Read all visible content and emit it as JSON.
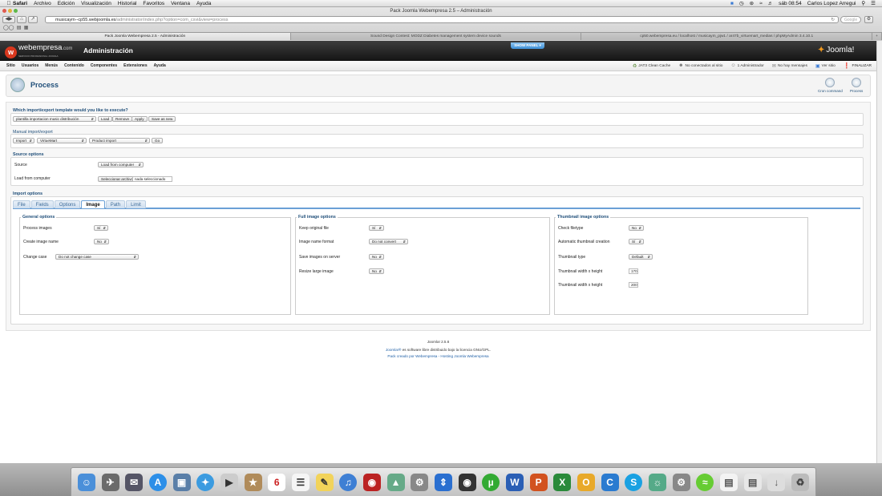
{
  "menubar": {
    "app": "Safari",
    "items": [
      "Archivo",
      "Edición",
      "Visualización",
      "Historial",
      "Favoritos",
      "Ventana",
      "Ayuda"
    ],
    "clock": "sáb 08:54",
    "user": "Carlos Lopez Arregui"
  },
  "browser": {
    "window_title": "Pack Joomla Webempresa 2.5 – Administración",
    "url_host": "musicaym--cp55.webjoomla.es",
    "url_path": "/administrator/index.php?option=com_csvi&view=process",
    "search_placeholder": "Google",
    "tabs": [
      "Pack Joomla Webempresa 2.5 - Administración",
      "Sound Design Contest: MODZ Diabetes management system device sounds",
      "cp50.webempresa.eu / localhost / musicaym_pjw1 / ar47b_virtuemart_medias / phpMyAdmin 3.4.10.1"
    ]
  },
  "header": {
    "brand": "webempresa",
    "brand_suffix": ".com",
    "brand_sub": "SERVICIO PROFESIONAL JOOMLA",
    "title": "Administración",
    "show_panel": "SHOW PANEL ▾",
    "joomla": "Joomla!"
  },
  "jmenu": {
    "items": [
      "Sitio",
      "Usuarios",
      "Menús",
      "Contenido",
      "Componentes",
      "Extensiones",
      "Ayuda"
    ],
    "status": [
      "JAT3 Clean Cache",
      "No conectados al sitio",
      "1 Administrador",
      "No hay mensajes",
      "Ver sitio",
      "FINALIZAR"
    ]
  },
  "toolbar": {
    "title": "Process",
    "cron": "Cron command",
    "process": "Process"
  },
  "template": {
    "question": "Which import/export template would you like to execute?",
    "selected": "plantilla importacion music distribución",
    "load": "Load",
    "remove": "Remove",
    "apply": "Apply",
    "save_as_new": "Save as new"
  },
  "manual": {
    "title": "Manual import/export",
    "action": "Import",
    "component": "VirtueMart",
    "operation": "Product import",
    "go": "Go"
  },
  "source": {
    "title": "Source options",
    "source_label": "Source",
    "source_value": "Load from computer",
    "load_label": "Load from computer",
    "file_button": "Seleccionar archivo",
    "file_status": "nada seleccionado"
  },
  "import_options": {
    "title": "Import options",
    "tabs": [
      "File",
      "Fields",
      "Options",
      "Image",
      "Path",
      "Limit"
    ],
    "active_tab": "Image"
  },
  "general": {
    "title": "General options",
    "rows": [
      {
        "label": "Process images",
        "value": "Sí"
      },
      {
        "label": "Create image name",
        "value": "No"
      },
      {
        "label": "Change case",
        "value": "Do not change case"
      }
    ]
  },
  "full": {
    "title": "Full image options",
    "rows": [
      {
        "label": "Keep original file",
        "value": "Sí"
      },
      {
        "label": "Image name format",
        "value": "Do not convert"
      },
      {
        "label": "Save images on server",
        "value": "No"
      },
      {
        "label": "Resize large image",
        "value": "No"
      }
    ]
  },
  "thumb": {
    "title": "Thumbnail image options",
    "rows": [
      {
        "label": "Check filetype",
        "value": "No"
      },
      {
        "label": "Automatic thumbnail creation",
        "value": "Sí"
      },
      {
        "label": "Thumbnail type",
        "value": "Default"
      },
      {
        "label": "Thumbnail width x height",
        "value": "170"
      },
      {
        "label": "Thumbnail width x height",
        "value": "200"
      }
    ]
  },
  "footer": {
    "version": "Joomla! 2.5.6",
    "license_link": "Joomla!®",
    "license_text": " es software libre distribuido bajo la licencia GNU/GPL.",
    "credit": "Pack creado por Webempresa - Hosting Joomla Webempresa"
  },
  "dock": [
    "finder",
    "launchpad",
    "mail",
    "app-store",
    "preview",
    "safari",
    "quicktime",
    "iphoto",
    "calendar",
    "reminders",
    "notes",
    "itunes",
    "photo-booth",
    "iphoto2",
    "system-preferences",
    "transmit",
    "steam",
    "utorrent",
    "word",
    "powerpoint",
    "excel",
    "outlook",
    "communicator",
    "skype",
    "network",
    "chrome",
    "spotify",
    "document",
    "document2",
    "downloads",
    "trash"
  ],
  "colors": {
    "accent": "#1f4e79",
    "tab_border": "#6aa0d6",
    "header_bg": "#1f1f1f"
  }
}
